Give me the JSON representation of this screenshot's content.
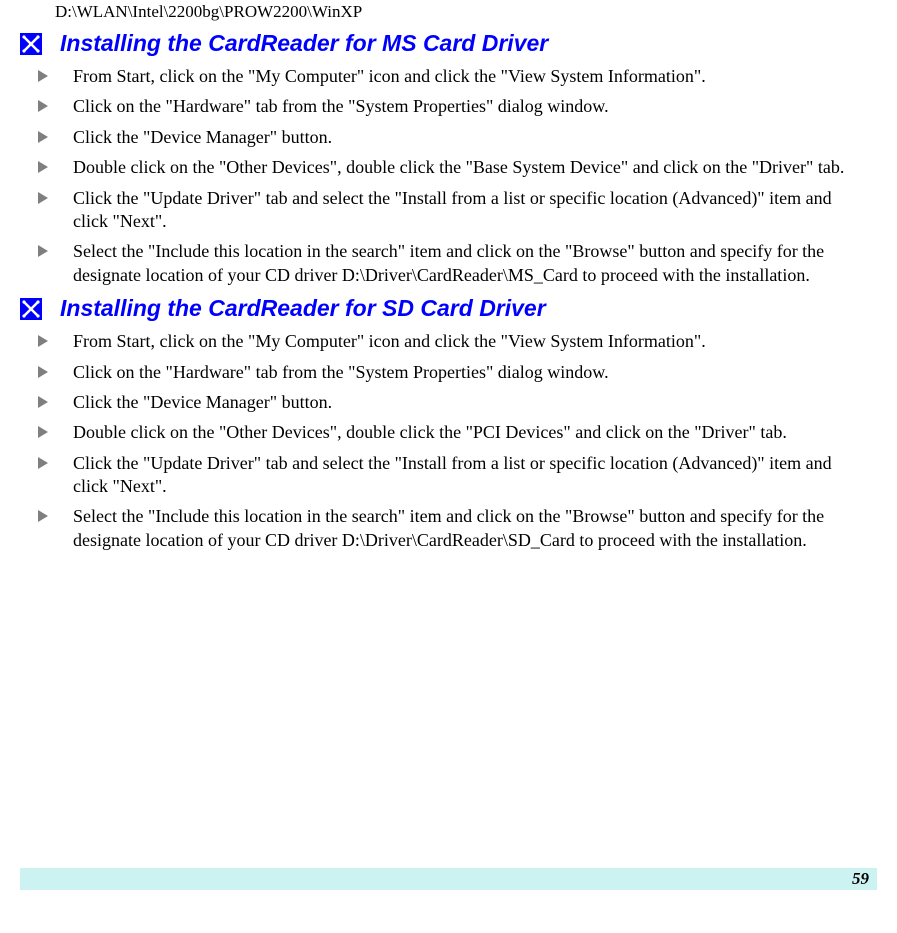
{
  "intro_path": "D:\\WLAN\\Intel\\2200bg\\PROW2200\\WinXP",
  "section1": {
    "title": "Installing the CardReader for MS Card Driver",
    "steps": [
      "From Start, click on the \"My Computer\" icon and click the \"View System Information\".",
      "Click on the \"Hardware\" tab from the \"System Properties\" dialog window.",
      "Click the \"Device Manager\" button.",
      "Double click on the \"Other Devices\", double click the \"Base System Device\" and click on the \"Driver\" tab.",
      "Click the \"Update Driver\" tab and select the \"Install from a list or specific location (Advanced)\" item and click \"Next\".",
      "Select the \"Include this location in the search\" item and click on the \"Browse\" button and specify for the designate location of your CD driver D:\\Driver\\CardReader\\MS_Card to proceed with the installation."
    ]
  },
  "section2": {
    "title": "Installing the CardReader for SD Card Driver",
    "steps": [
      "From Start, click on the \"My Computer\" icon and click the \"View System Information\".",
      "Click on the \"Hardware\" tab from the \"System Properties\" dialog window.",
      "Click the \"Device Manager\" button.",
      "Double click on the \"Other Devices\", double click the \"PCI Devices\" and click on the \"Driver\" tab.",
      "Click the \"Update Driver\" tab and select the \"Install from a list or specific location (Advanced)\" item and click \"Next\".",
      "Select the \"Include this location in the search\" item and click on the \"Browse\" button and specify for the designate location of your CD driver D:\\Driver\\CardReader\\SD_Card to proceed with the installation."
    ]
  },
  "page_number": "59"
}
